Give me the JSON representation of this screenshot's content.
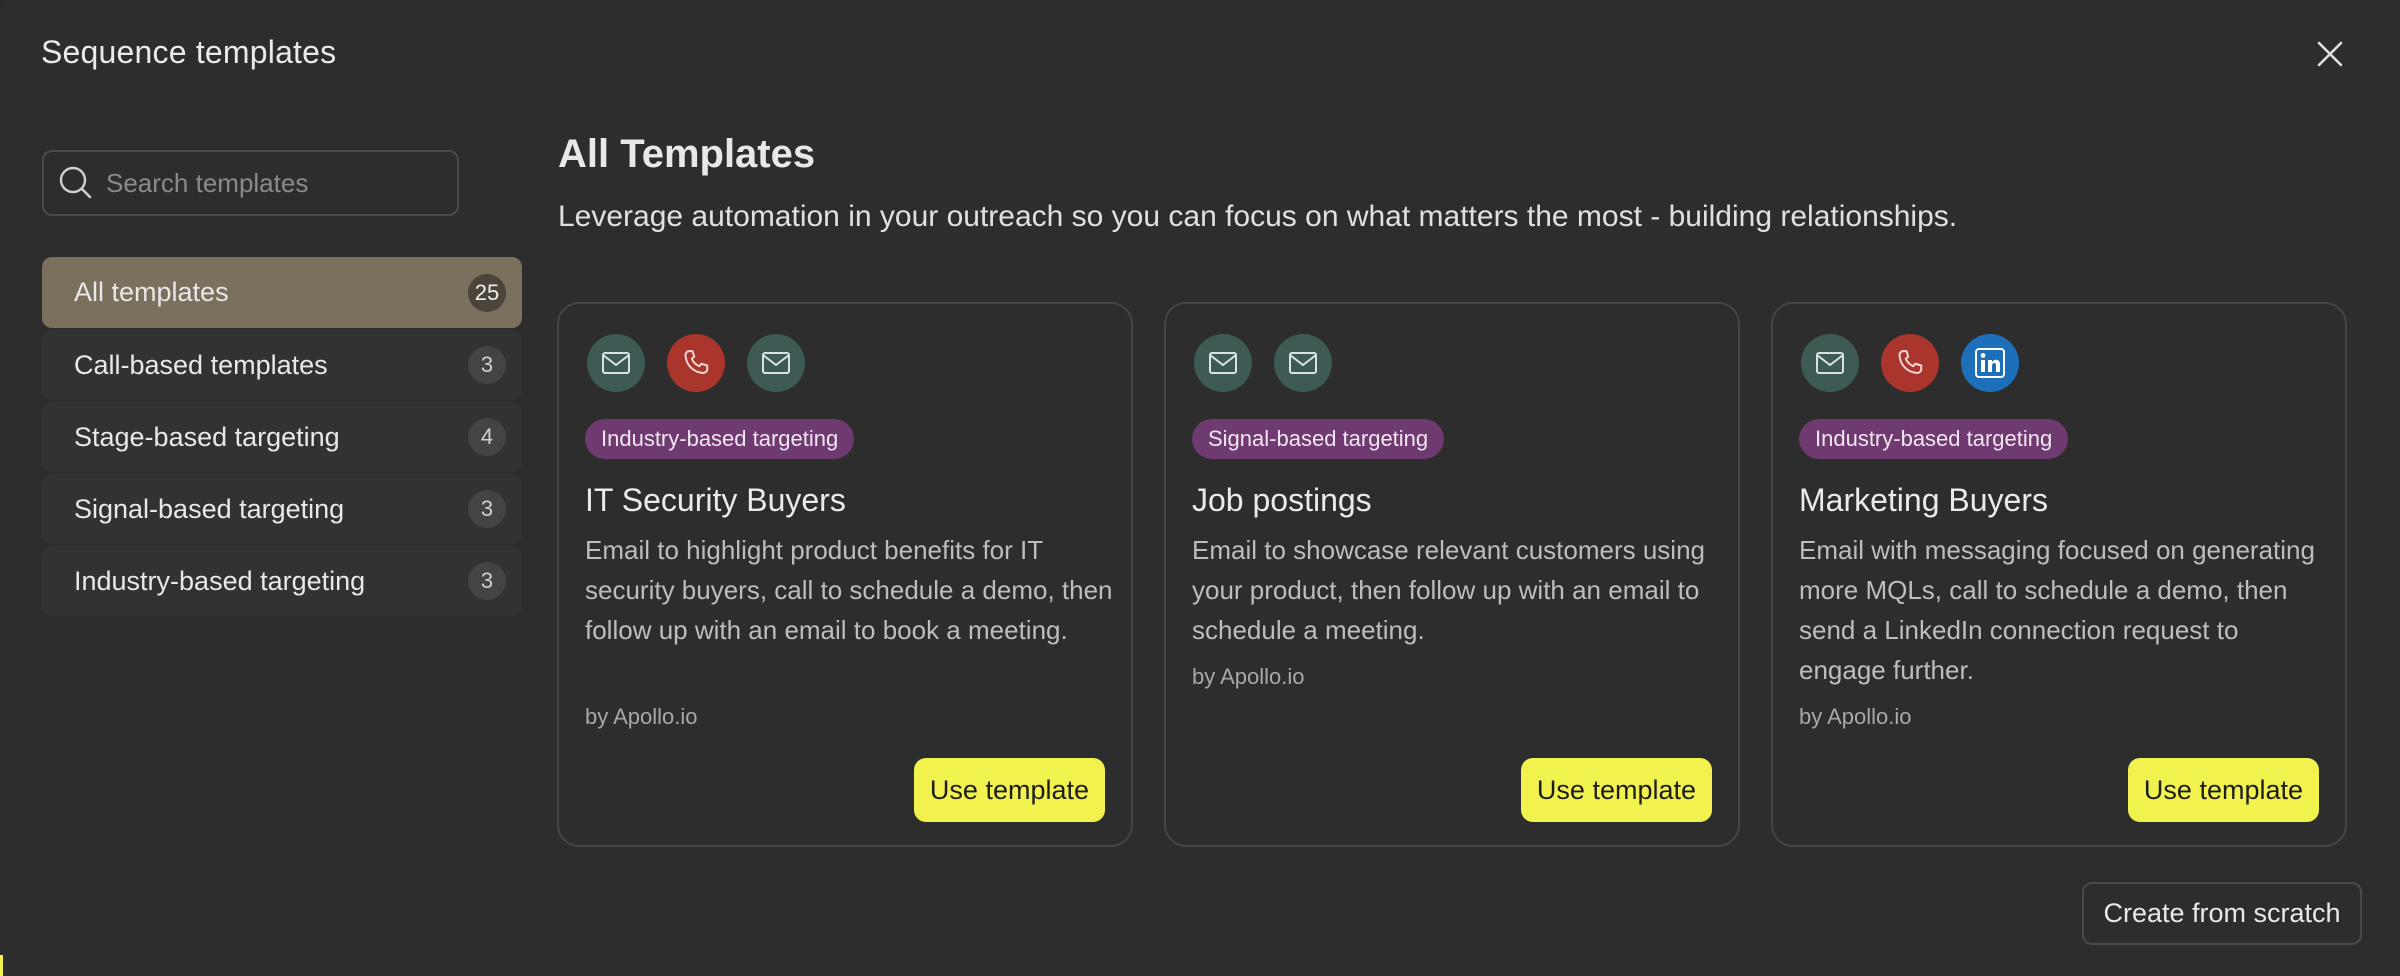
{
  "modal": {
    "title": "Sequence templates",
    "close_icon": "close-icon"
  },
  "search": {
    "placeholder": "Search templates",
    "icon": "search-icon"
  },
  "sidebar": {
    "items": [
      {
        "label": "All templates",
        "count": "25",
        "active": true
      },
      {
        "label": "Call-based templates",
        "count": "3"
      },
      {
        "label": "Stage-based targeting",
        "count": "4"
      },
      {
        "label": "Signal-based targeting",
        "count": "3"
      },
      {
        "label": "Industry-based targeting",
        "count": "3"
      }
    ]
  },
  "main": {
    "title": "All Templates",
    "subtitle": "Leverage automation in your outreach so you can focus on what matters the most - building relationships."
  },
  "cards": [
    {
      "icons": [
        "email-icon",
        "phone-icon",
        "email-icon"
      ],
      "tag": "Industry-based targeting",
      "title": "IT Security Buyers",
      "description": "Email to highlight product benefits for IT security buyers, call to schedule a demo, then follow up with an email to book a meeting.",
      "author": "by Apollo.io",
      "button": "Use template"
    },
    {
      "icons": [
        "email-icon",
        "email-icon"
      ],
      "tag": "Signal-based targeting",
      "title": "Job postings",
      "description": "Email to showcase relevant customers using your product, then follow up with an email to schedule a meeting.",
      "author": "by Apollo.io",
      "button": "Use template"
    },
    {
      "icons": [
        "email-icon",
        "phone-icon",
        "linkedin-icon"
      ],
      "tag": "Industry-based targeting",
      "title": "Marketing Buyers",
      "description": "Email with messaging focused on generating more MQLs, call to schedule a demo, then send a LinkedIn connection request to engage further.",
      "author": "by Apollo.io",
      "button": "Use template"
    }
  ],
  "footer": {
    "create_label": "Create from scratch"
  },
  "colors": {
    "background": "#2d2d2d",
    "active_item": "#7b6f5d",
    "tag": "#6e3a6f",
    "primary_button": "#f2f24f",
    "email_icon_bg": "#3e5a55",
    "phone_icon_bg": "#a9352c",
    "linkedin_icon_bg": "#1c6fb8"
  }
}
